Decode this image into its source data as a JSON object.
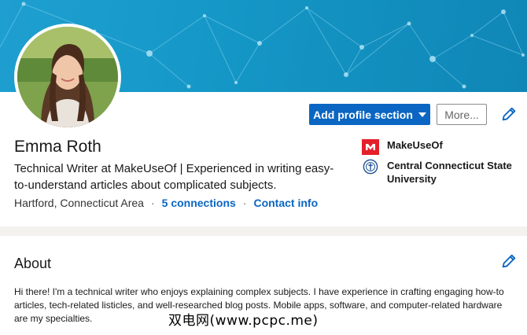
{
  "profile": {
    "name": "Emma Roth",
    "headline": "Technical Writer at MakeUseOf | Experienced in writing easy-to-understand articles about complicated subjects.",
    "location": "Hartford, Connecticut Area",
    "separator": "·",
    "connections": "5 connections",
    "contact_info": "Contact info"
  },
  "actions": {
    "add_section_label": "Add profile section",
    "more_label": "More..."
  },
  "experience": {
    "company": "MakeUseOf",
    "school": "Central Connecticut State University"
  },
  "about": {
    "title": "About",
    "text": "Hi there! I'm a technical writer who enjoys explaining complex subjects. I have experience in crafting engaging how-to articles, tech-related listicles, and well-researched blog posts. Mobile apps, software, and computer-related hardware are my specialties."
  },
  "watermark": "双电网(www.pcpc.me)",
  "colors": {
    "primary_blue": "#0a66c2",
    "banner_blue": "#1598c7",
    "makeuseof_red": "#e4202a",
    "page_bg": "#f3f2ef"
  },
  "icons": {
    "edit": "pencil-icon",
    "dropdown": "caret-down-icon",
    "company_logo": "makeuseof-logo",
    "school_logo": "ccsu-seal"
  }
}
